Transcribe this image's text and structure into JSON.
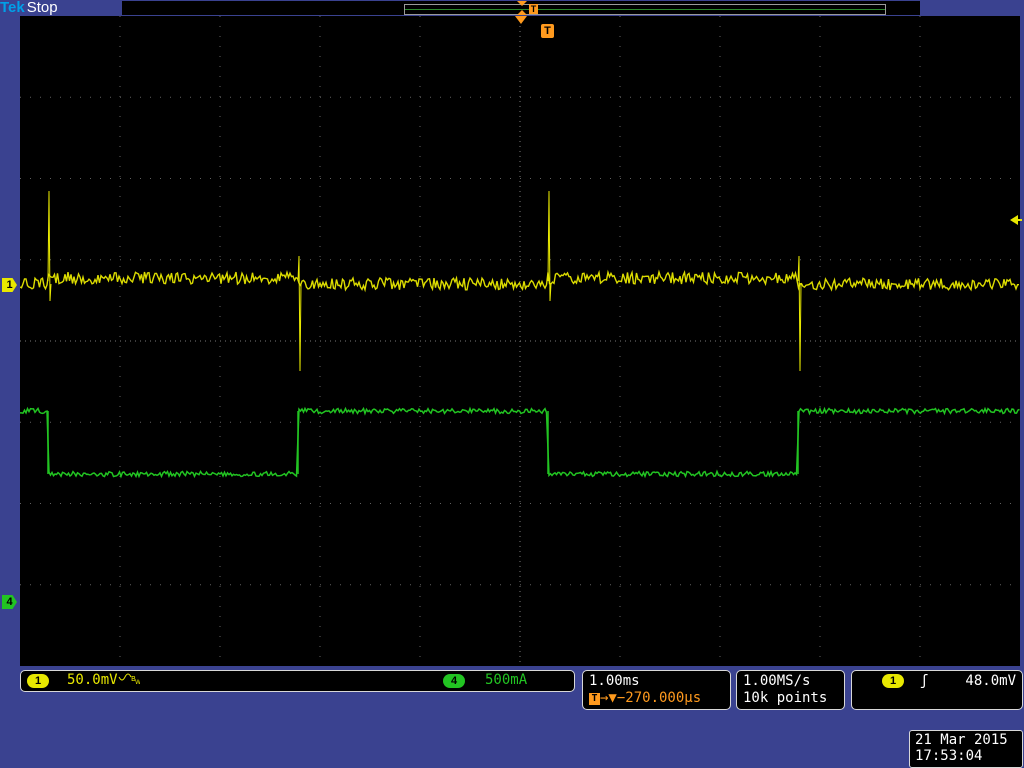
{
  "header": {
    "brand": "Tek",
    "acq_state": "Stop"
  },
  "trigger_marker_label": "T",
  "channels": [
    {
      "id": "1",
      "color": "#e8e800",
      "scale": "50.0mV",
      "coupling_icon": "bandwidth-limit-icon"
    },
    {
      "id": "4",
      "color": "#22c422",
      "scale": "500mA"
    }
  ],
  "horizontal": {
    "scale": "1.00ms",
    "trigger_label": "T",
    "position": "→▼−270.000µs"
  },
  "acquisition": {
    "sample_rate": "1.00MS/s",
    "record_length": "10k points"
  },
  "trigger": {
    "source": "1",
    "slope": "ʃ",
    "level": "48.0mV"
  },
  "datetime": {
    "date": "21 Mar 2015",
    "time": "17:53:04"
  },
  "colors": {
    "background": "#3a4290",
    "screen": "#000000",
    "trigger": "#ff9a1e",
    "ch1": "#e8e800",
    "ch4": "#22c422"
  }
}
